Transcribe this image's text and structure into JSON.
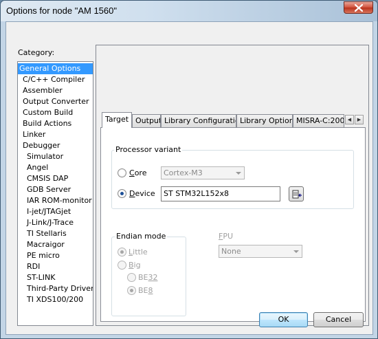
{
  "window": {
    "title": "Options for node \"AM 1560\""
  },
  "category": {
    "label": "Category:",
    "items": [
      "General Options",
      "C/C++ Compiler",
      "Assembler",
      "Output Converter",
      "Custom Build",
      "Build Actions",
      "Linker",
      "Debugger",
      "Simulator",
      "Angel",
      "CMSIS DAP",
      "GDB Server",
      "IAR ROM-monitor",
      "I-jet/JTAGjet",
      "J-Link/J-Trace",
      "TI Stellaris",
      "Macraigor",
      "PE micro",
      "RDI",
      "ST-LINK",
      "Third-Party Driver",
      "TI XDS100/200"
    ],
    "selected": "General Options"
  },
  "tabs": [
    "Target",
    "Output",
    "Library Configuration",
    "Library Options",
    "MISRA-C:200"
  ],
  "active_tab": "Target",
  "processor_variant": {
    "legend": "Processor variant",
    "core": {
      "label_first": "C",
      "label_rest": "ore",
      "value": "Cortex-M3",
      "selected": false
    },
    "device": {
      "label_first": "D",
      "label_rest": "evice",
      "value": "ST STM32L152x8",
      "selected": true
    }
  },
  "endian_mode": {
    "legend": "Endian mode",
    "little": {
      "label_first": "L",
      "label_rest": "ittle",
      "selected": true
    },
    "big": {
      "label_first": "B",
      "label_rest": "ig",
      "selected": false
    },
    "be32": {
      "label_first": "BE",
      "label_rest": "32",
      "selected": false
    },
    "be8": {
      "label_first": "BE",
      "label_rest": "8",
      "selected": true
    }
  },
  "fpu": {
    "label_first": "F",
    "label_rest": "PU",
    "value": "None"
  },
  "buttons": {
    "ok": "OK",
    "cancel": "Cancel"
  },
  "icons": {
    "close": "close-icon",
    "device_select": "device-select-icon",
    "tab_prev": "chevron-left-icon",
    "tab_next": "chevron-right-icon"
  }
}
